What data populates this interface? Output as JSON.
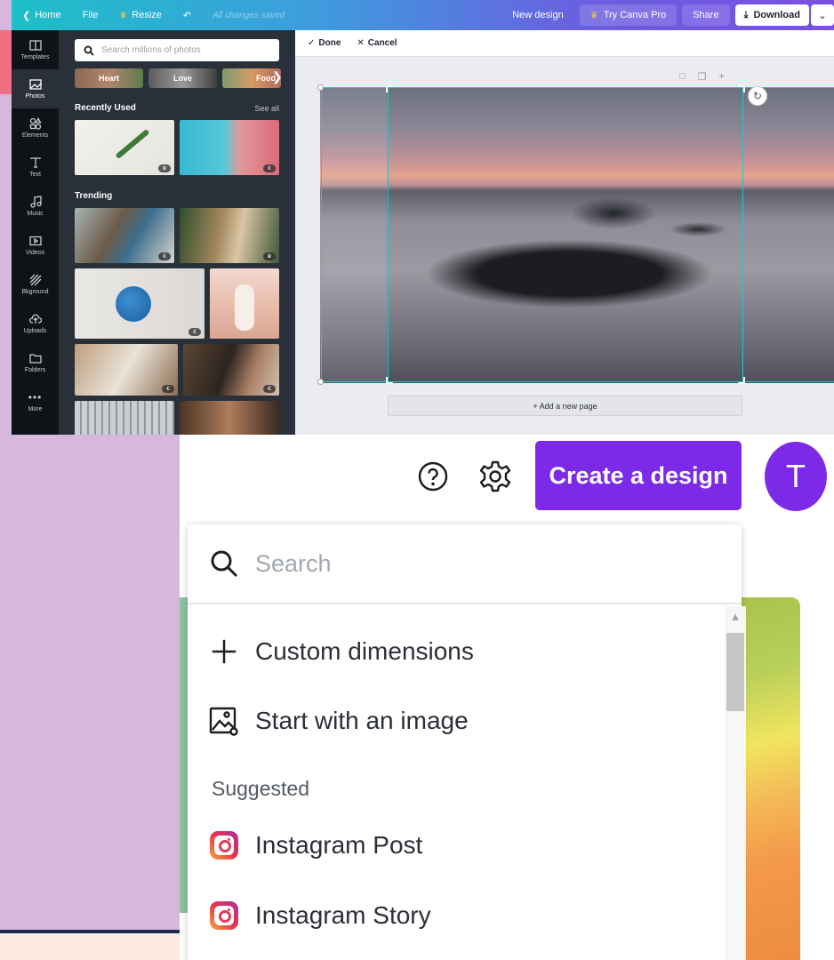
{
  "topbar": {
    "home": "Home",
    "file": "File",
    "resize": "Resize",
    "saved_status": "All changes saved",
    "new_design": "New design",
    "try_pro": "Try Canva Pro",
    "share": "Share",
    "download": "Download"
  },
  "rail": {
    "items": [
      {
        "label": "Templates",
        "icon": "templates-icon"
      },
      {
        "label": "Photos",
        "icon": "photos-icon"
      },
      {
        "label": "Elements",
        "icon": "elements-icon"
      },
      {
        "label": "Text",
        "icon": "text-icon"
      },
      {
        "label": "Music",
        "icon": "music-icon"
      },
      {
        "label": "Videos",
        "icon": "videos-icon"
      },
      {
        "label": "Bkground",
        "icon": "background-icon"
      },
      {
        "label": "Uploads",
        "icon": "uploads-icon"
      },
      {
        "label": "Folders",
        "icon": "folders-icon"
      },
      {
        "label": "More",
        "icon": "more-icon"
      }
    ]
  },
  "photos_panel": {
    "search_placeholder": "Search millions of photos",
    "chips": [
      "Heart",
      "Love",
      "Food"
    ],
    "recently_used": "Recently Used",
    "see_all": "See all",
    "trending": "Trending"
  },
  "editor": {
    "done": "Done",
    "cancel": "Cancel",
    "add_page": "+ Add a new page"
  },
  "home": {
    "create_button": "Create a design",
    "avatar_letter": "T",
    "search_placeholder": "Search",
    "items": {
      "custom_dimensions": "Custom dimensions",
      "start_with_image": "Start with an image",
      "suggested": "Suggested",
      "instagram_post": "Instagram Post",
      "instagram_story": "Instagram Story"
    }
  },
  "colors": {
    "canva_purple": "#7d2ae8",
    "selection_teal": "#1ec8d0",
    "panel_dark": "#293039"
  }
}
